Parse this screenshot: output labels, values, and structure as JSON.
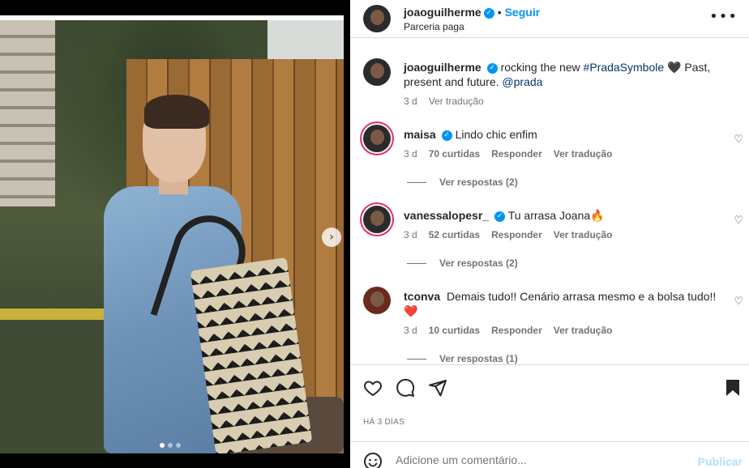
{
  "header": {
    "username": "joaoguilherme",
    "follow_label": "Seguir",
    "subtitle": "Parceria paga",
    "more_icon": "more-horizontal-icon"
  },
  "caption": {
    "username": "joaoguilherme",
    "text_before": "rocking the new ",
    "hashtag": "#PradaSymbole",
    "text_after": " 🖤 Past, present and future. ",
    "mention": "@prada",
    "time": "3 d",
    "translate": "Ver tradução"
  },
  "comments": [
    {
      "username": "maisa",
      "verified": true,
      "text": "Lindo chic enfim",
      "time": "3 d",
      "likes": "70 curtidas",
      "reply": "Responder",
      "translate": "Ver tradução",
      "view_replies": "Ver respostas (2)"
    },
    {
      "username": "vanessalopesr_",
      "verified": true,
      "text": "Tu arrasa Joana🔥",
      "time": "3 d",
      "likes": "52 curtidas",
      "reply": "Responder",
      "translate": "Ver tradução",
      "view_replies": "Ver respostas (2)"
    },
    {
      "username": "tconva",
      "verified": false,
      "text": "Demais tudo!! Cenário arrasa mesmo e a bolsa tudo!! ❤️",
      "time": "3 d",
      "likes": "10 curtidas",
      "reply": "Responder",
      "translate": "Ver tradução",
      "view_replies": "Ver respostas (1)"
    }
  ],
  "actions": {
    "like_icon": "heart-icon",
    "comment_icon": "comment-icon",
    "share_icon": "send-icon",
    "save_icon": "bookmark-icon",
    "date": "HÁ 3 DIAS"
  },
  "add_comment": {
    "placeholder": "Adicione um comentário...",
    "publish_label": "Publicar"
  },
  "media": {
    "next_icon": "chevron-right-icon",
    "total_slides": 3,
    "current_slide": 1
  },
  "colors": {
    "link_blue": "#0095f6",
    "text": "#262626",
    "muted": "#737373",
    "border": "#dbdbdb"
  }
}
